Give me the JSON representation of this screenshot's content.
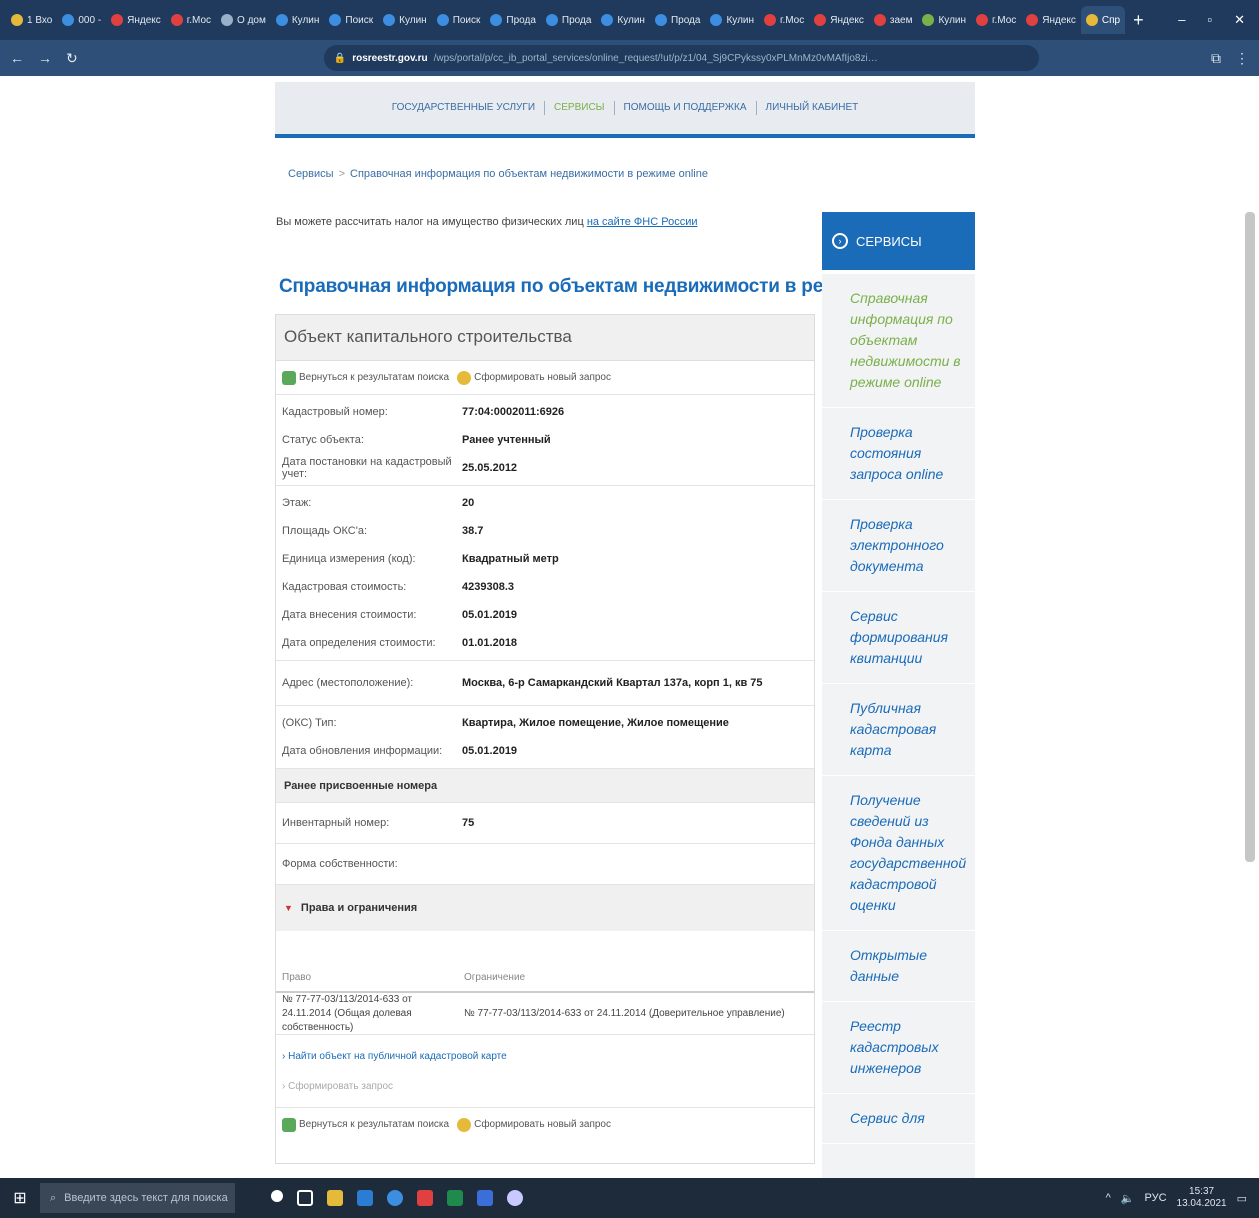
{
  "browser": {
    "tabs": [
      {
        "label": "1 Вхо",
        "color": "#e5b93a"
      },
      {
        "label": "000 -",
        "color": "#3b8ee0"
      },
      {
        "label": "Яндекс",
        "color": "#e04040"
      },
      {
        "label": "г.Мос",
        "color": "#e04040"
      },
      {
        "label": "О дом",
        "color": "#9ab0c8"
      },
      {
        "label": "Кулин",
        "color": "#3b8ee0"
      },
      {
        "label": "Поиск",
        "color": "#3b8ee0"
      },
      {
        "label": "Кулин",
        "color": "#3b8ee0"
      },
      {
        "label": "Поиск",
        "color": "#3b8ee0"
      },
      {
        "label": "Прода",
        "color": "#3b8ee0"
      },
      {
        "label": "Прода",
        "color": "#3b8ee0"
      },
      {
        "label": "Кулин",
        "color": "#3b8ee0"
      },
      {
        "label": "Прода",
        "color": "#3b8ee0"
      },
      {
        "label": "Кулин",
        "color": "#3b8ee0"
      },
      {
        "label": "г.Мос",
        "color": "#e04040"
      },
      {
        "label": "Яндекс",
        "color": "#e04040"
      },
      {
        "label": "заем",
        "color": "#e04040"
      },
      {
        "label": "Кулин",
        "color": "#7ab04a"
      },
      {
        "label": "г.Мос",
        "color": "#e04040"
      },
      {
        "label": "Яндекс",
        "color": "#e04040"
      },
      {
        "label": "Спр",
        "color": "#e5b93a",
        "active": true
      }
    ],
    "new_tab": "+",
    "address_host": "rosreestr.gov.ru",
    "address_path": "/wps/portal/p/cc_ib_portal_services/online_request/!ut/p/z1/04_Sj9CPykssy0xPLMnMz0vMAfIjo8zi…"
  },
  "topnav": {
    "items": [
      "ГОСУДАРСТВЕННЫЕ УСЛУГИ",
      "СЕРВИСЫ",
      "ПОМОЩЬ И ПОДДЕРЖКА",
      "ЛИЧНЫЙ КАБИНЕТ"
    ],
    "current_index": 1
  },
  "breadcrumb": {
    "root": "Сервисы",
    "separator": ">",
    "current": "Справочная информация по объектам недвижимости в режиме online"
  },
  "tax_note": {
    "text": "Вы можете рассчитать налог на имущество физических лиц",
    "link": "на сайте ФНС России"
  },
  "page_title": "Справочная информация по объектам недвижимости в режиме online",
  "card": {
    "title": "Объект капитального строительства",
    "back_label": "Вернуться к результатам поиска",
    "new_request_label": "Сформировать новый запрос",
    "groups": [
      [
        {
          "k": "Кадастровый номер:",
          "v": "77:04:0002011:6926"
        },
        {
          "k": "Статус объекта:",
          "v": "Ранее учтенный"
        },
        {
          "k": "Дата постановки на кадастровый учет:",
          "v": "25.05.2012"
        }
      ],
      [
        {
          "k": "Этаж:",
          "v": "20"
        },
        {
          "k": "Площадь ОКС'a:",
          "v": "38.7"
        },
        {
          "k": "Единица измерения (код):",
          "v": "Квадратный метр"
        },
        {
          "k": "Кадастровая стоимость:",
          "v": "4239308.3"
        },
        {
          "k": "Дата внесения стоимости:",
          "v": "05.01.2019"
        },
        {
          "k": "Дата определения стоимости:",
          "v": "01.01.2018"
        }
      ],
      [
        {
          "k": "Адрес (местоположение):",
          "v": "Москва, 6-р Самаркандский Квартал 137а, корп 1, кв 75"
        }
      ],
      [
        {
          "k": "(ОКС) Тип:",
          "v": "Квартира, Жилое помещение, Жилое помещение"
        },
        {
          "k": "Дата обновления информации:",
          "v": "05.01.2019"
        }
      ]
    ],
    "prev_numbers_head": "Ранее присвоенные номера",
    "inventory": {
      "k": "Инвентарный номер:",
      "v": "75"
    },
    "ownership": {
      "k": "Форма собственности:",
      "v": ""
    },
    "rights_head": "Права и ограничения",
    "rights_cols": [
      "Право",
      "Ограничение"
    ],
    "rights_row": {
      "right": "№ 77-77-03/113/2014-633  от 24.11.2014 (Общая долевая собственность)",
      "restriction": "№ 77-77-03/113/2014-633  от 24.11.2014  (Доверительное управление)"
    },
    "link_map": "› Найти объект на публичной кадастровой карте",
    "link_request": "› Сформировать запрос"
  },
  "services": {
    "heading": "СЕРВИСЫ",
    "items": [
      "Справочная информация по объектам недвижимости в режиме online",
      "Проверка состояния запроса online",
      "Проверка электронного документа",
      "Сервис формирования квитанции",
      "Публичная кадастровая карта",
      "Получение сведений из Фонда данных государственной кадастровой оценки",
      "Открытые данные",
      "Реестр кадастровых инженеров",
      "Сервис для"
    ],
    "current_index": 0
  },
  "taskbar": {
    "search_placeholder": "Введите здесь текст для поиска",
    "lang": "РУС",
    "time": "15:37",
    "date": "13.04.2021"
  },
  "colors": {
    "brand_blue": "#1a6bb8",
    "active_green": "#7ab04a"
  }
}
